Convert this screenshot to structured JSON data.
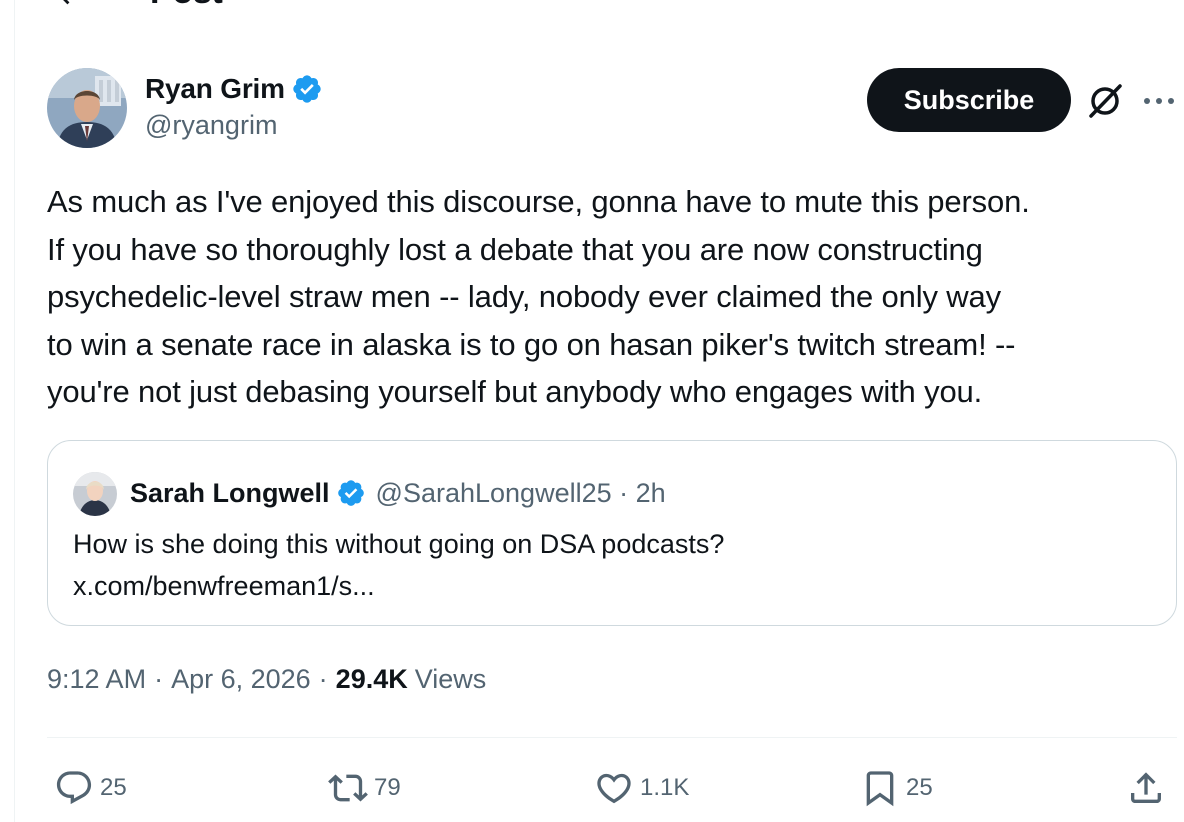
{
  "header": {
    "title": "Post"
  },
  "author": {
    "display_name": "Ryan Grim",
    "handle": "@ryangrim",
    "verified": true
  },
  "actions_top": {
    "subscribe_label": "Subscribe"
  },
  "post": {
    "text": "As much as I've enjoyed this discourse, gonna have to mute this person.\nIf you have so thoroughly lost a debate that you are now constructing\npsychedelic-level straw men -- lady, nobody ever claimed the only way\nto win a senate race in alaska is to go on hasan piker's twitch stream! --\nyou're not just debasing yourself but anybody who engages with you."
  },
  "quote": {
    "display_name": "Sarah Longwell",
    "handle_time": "@SarahLongwell25 · 2h",
    "text_line1": "How is she doing this without going on DSA podcasts?",
    "text_line2": "x.com/benwfreeman1/s..."
  },
  "meta": {
    "time": "9:12 AM",
    "date": "Apr 6, 2026",
    "views_count": "29.4K",
    "views_label": "Views"
  },
  "engagement": {
    "replies": "25",
    "reposts": "79",
    "likes": "1.1K",
    "bookmarks": "25"
  },
  "colors": {
    "text": "#0f1419",
    "secondary": "#536471",
    "verified_blue": "#1d9bf0",
    "border": "#cfd9de"
  },
  "icons": [
    "back-arrow-icon",
    "verified-icon",
    "grok-icon",
    "more-icon",
    "reply-icon",
    "repost-icon",
    "like-icon",
    "bookmark-icon",
    "share-icon"
  ]
}
